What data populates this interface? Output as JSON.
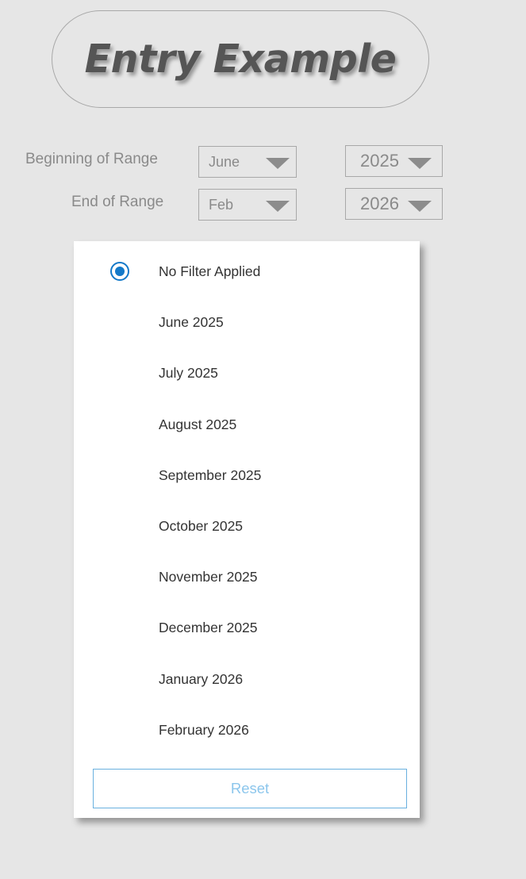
{
  "title": "Entry Example",
  "range": {
    "beginning_label": "Beginning of Range",
    "beginning_month": "June",
    "beginning_year": "2025",
    "end_label": "End of Range",
    "end_month": "Feb",
    "end_year": "2026"
  },
  "filter_menu": {
    "selected_index": 0,
    "options": [
      "No Filter Applied",
      "June 2025",
      "July 2025",
      "August 2025",
      "September 2025",
      "October 2025",
      "November 2025",
      "December 2025",
      "January 2026",
      "February 2026"
    ],
    "reset_label": "Reset"
  },
  "colors": {
    "background": "#e6e6e6",
    "radio_accent": "#1379c9",
    "reset_border": "#69b0df",
    "reset_text": "#8cc6ec"
  }
}
